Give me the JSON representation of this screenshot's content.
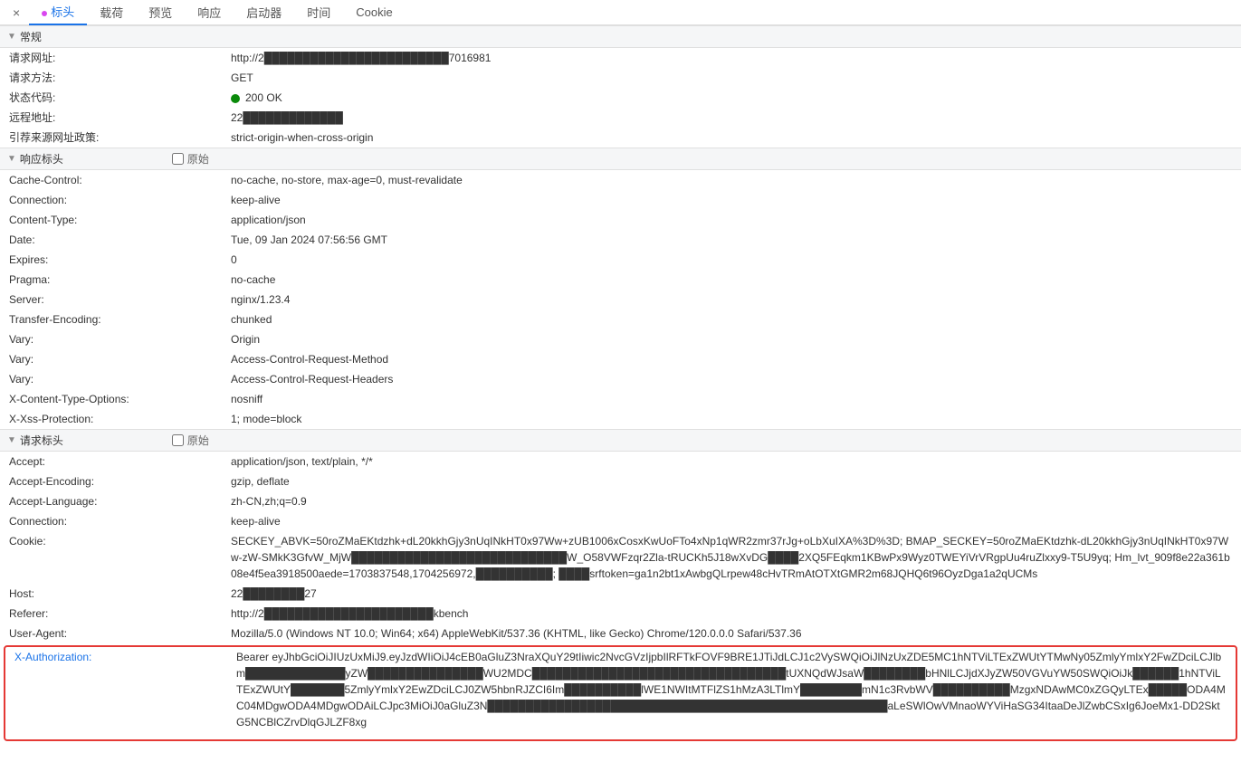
{
  "tabs": {
    "close": "×",
    "items": [
      "标头",
      "载荷",
      "预览",
      "响应",
      "启动器",
      "时间",
      "Cookie"
    ],
    "active": 0
  },
  "general": {
    "title": "常规",
    "rows": [
      {
        "label": "请求网址:",
        "value": "http://2████████████████████████7016981"
      },
      {
        "label": "请求方法:",
        "value": "GET"
      },
      {
        "label": "状态代码:",
        "value": "200 OK",
        "status": true
      },
      {
        "label": "远程地址:",
        "value": "22█████████████"
      },
      {
        "label": "引荐来源网址政策:",
        "value": "strict-origin-when-cross-origin"
      }
    ]
  },
  "response_headers": {
    "title": "响应标头",
    "raw": "原始",
    "rows": [
      {
        "label": "Cache-Control:",
        "value": "no-cache, no-store, max-age=0, must-revalidate"
      },
      {
        "label": "Connection:",
        "value": "keep-alive"
      },
      {
        "label": "Content-Type:",
        "value": "application/json"
      },
      {
        "label": "Date:",
        "value": "Tue, 09 Jan 2024 07:56:56 GMT"
      },
      {
        "label": "Expires:",
        "value": "0"
      },
      {
        "label": "Pragma:",
        "value": "no-cache"
      },
      {
        "label": "Server:",
        "value": "nginx/1.23.4"
      },
      {
        "label": "Transfer-Encoding:",
        "value": "chunked"
      },
      {
        "label": "Vary:",
        "value": "Origin"
      },
      {
        "label": "Vary:",
        "value": "Access-Control-Request-Method"
      },
      {
        "label": "Vary:",
        "value": "Access-Control-Request-Headers"
      },
      {
        "label": "X-Content-Type-Options:",
        "value": "nosniff"
      },
      {
        "label": "X-Xss-Protection:",
        "value": "1; mode=block"
      }
    ]
  },
  "request_headers": {
    "title": "请求标头",
    "raw": "原始",
    "rows": [
      {
        "label": "Accept:",
        "value": "application/json, text/plain, */*"
      },
      {
        "label": "Accept-Encoding:",
        "value": "gzip, deflate"
      },
      {
        "label": "Accept-Language:",
        "value": "zh-CN,zh;q=0.9"
      },
      {
        "label": "Connection:",
        "value": "keep-alive"
      },
      {
        "label": "Cookie:",
        "value": "SECKEY_ABVK=50roZMaEKtdzhk+dL20kkhGjy3nUqINkHT0x97Ww+zUB1006xCosxKwUoFTo4xNp1qWR2zmr37rJg+oLbXuIXA%3D%3D; BMAP_SECKEY=50roZMaEKtdzhk-dL20kkhGjy3nUqINkHT0x97Ww-zW-SMkK3GfvW_MjW████████████████████████████W_O58VWFzqr2Zla-tRUCKh5J18wXvDG████2XQ5FEqkm1KBwPx9Wyz0TWEYiVrVRgpUu4ruZlxxy9-T5U9yq; Hm_lvt_909f8e22a361b08e4f5ea3918500aede=1703837548,1704256972,██████████; ████srftoken=ga1n2bt1xAwbgQLrpew48cHvTRmAtOTXtGMR2m68JQHQ6t96OyzDga1a2qUCMs"
      },
      {
        "label": "Host:",
        "value": "22████████27"
      },
      {
        "label": "Referer:",
        "value": "http://2██████████████████████kbench"
      },
      {
        "label": "User-Agent:",
        "value": "Mozilla/5.0 (Windows NT 10.0; Win64; x64) AppleWebKit/537.36 (KHTML, like Gecko) Chrome/120.0.0.0 Safari/537.36"
      }
    ],
    "xauth": {
      "label": "X-Authorization:",
      "value": "Bearer eyJhbGciOiJIUzUxMiJ9.eyJzdWIiOiJ4cEB0aGluZ3NraXQuY29tIiwic2NvcGVzIjpbIlRFTkFOVF9BRE1JTiJdLCJ1c2VySWQiOiJlNzUxZDE5MC1hNTViLTExZWUtYTMwNy05ZmlyYmlxY2FwZDciLCJlbm█████████████yZW███████████████WU2MDC█████████████████████████████████tUXNQdWJsaW████████bHNlLCJjdXJyZW50VGVuYW50SWQiOiJk██████1hNTViLTExZWUtY███████5ZmlyYmlxY2EwZDciLCJ0ZW5hbnRJZCI6Im██████████lWE1NWItMTFlZS1hMzA3LTlmY████████mN1c3RvbWV██████████MzgxNDAwMC0xZGQyLTEx█████ODA4MC04MDgwODA4MDgwODAiLCJpc3MiOiJ0aGluZ3N████████████████████████████████████████████████████aLeSWlOwVMnaoWYViHaSG34ItaaDeJlZwbCSxIg6JoeMx1-DD2SktG5NCBlCZrvDlqGJLZF8xg"
    }
  }
}
